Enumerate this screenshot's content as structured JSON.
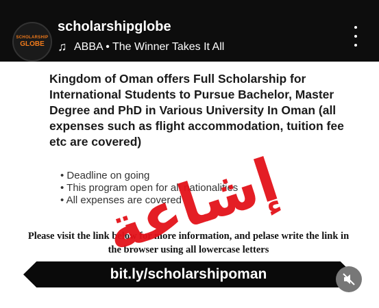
{
  "header": {
    "avatar_line1": "SCHOLARSHIP",
    "avatar_line2": "GLOBE",
    "username": "scholarshipglobe",
    "music_icon": "♫",
    "song": "ABBA • The Winner Takes It All"
  },
  "post": {
    "headline": "Kingdom of Oman offers Full Scholarship for International Students to Pursue Bachelor, Master Degree and PhD in Various University In Oman (all expenses such as flight accommodation, tuition fee etc are covered)",
    "bullets": [
      "Deadline on going",
      "This program open for all nationalities",
      "All expenses are covered"
    ],
    "instruction": "Please visit the link below for more information, and pelase write the link in the browser using all lowercase letters",
    "link": "bit.ly/scholarshipoman",
    "stamp_text": "إشاعة"
  },
  "colors": {
    "stamp": "#e3121a",
    "header_bg": "#0d0d0d",
    "avatar_accent": "#f07a1a"
  },
  "icons": [
    "more-vertical-icon",
    "music-note-icon",
    "mute-icon"
  ]
}
